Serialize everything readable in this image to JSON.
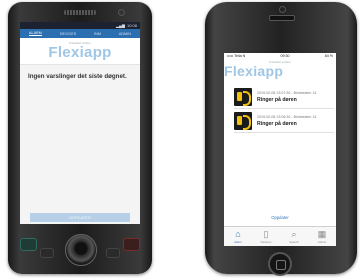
{
  "android": {
    "status_time": "10:08",
    "tabs": [
      "ALARM",
      "DEVICES",
      "BIM",
      "ADMIN"
    ],
    "active_tab": 0,
    "logo_sub": "Frankfurt Lisbon",
    "logo": "Flexiapp",
    "message": "Ingen varslinger det siste døgnet.",
    "bottom_button": "OPPDATER"
  },
  "iphone": {
    "status_carrier": "••••• Telia N",
    "status_time": "09:30",
    "status_battery": "84 %",
    "logo_sub": "Frankfurt Lisbon",
    "logo": "Flexiapp",
    "items": [
      {
        "meta": "2019-02-08 13:07:30 - Bindvealen 14",
        "title": "Ringer på døren"
      },
      {
        "meta": "2019-02-08 13:06:30 - Bindvealen 14",
        "title": "Ringer på døren"
      }
    ],
    "refresh": "Oppdater",
    "tabbar": [
      {
        "label": "Alarm",
        "icon": "home-icon"
      },
      {
        "label": "Devices",
        "icon": "device-icon"
      },
      {
        "label": "Search",
        "icon": "search-icon"
      },
      {
        "label": "Admin",
        "icon": "calendar-icon"
      }
    ]
  }
}
